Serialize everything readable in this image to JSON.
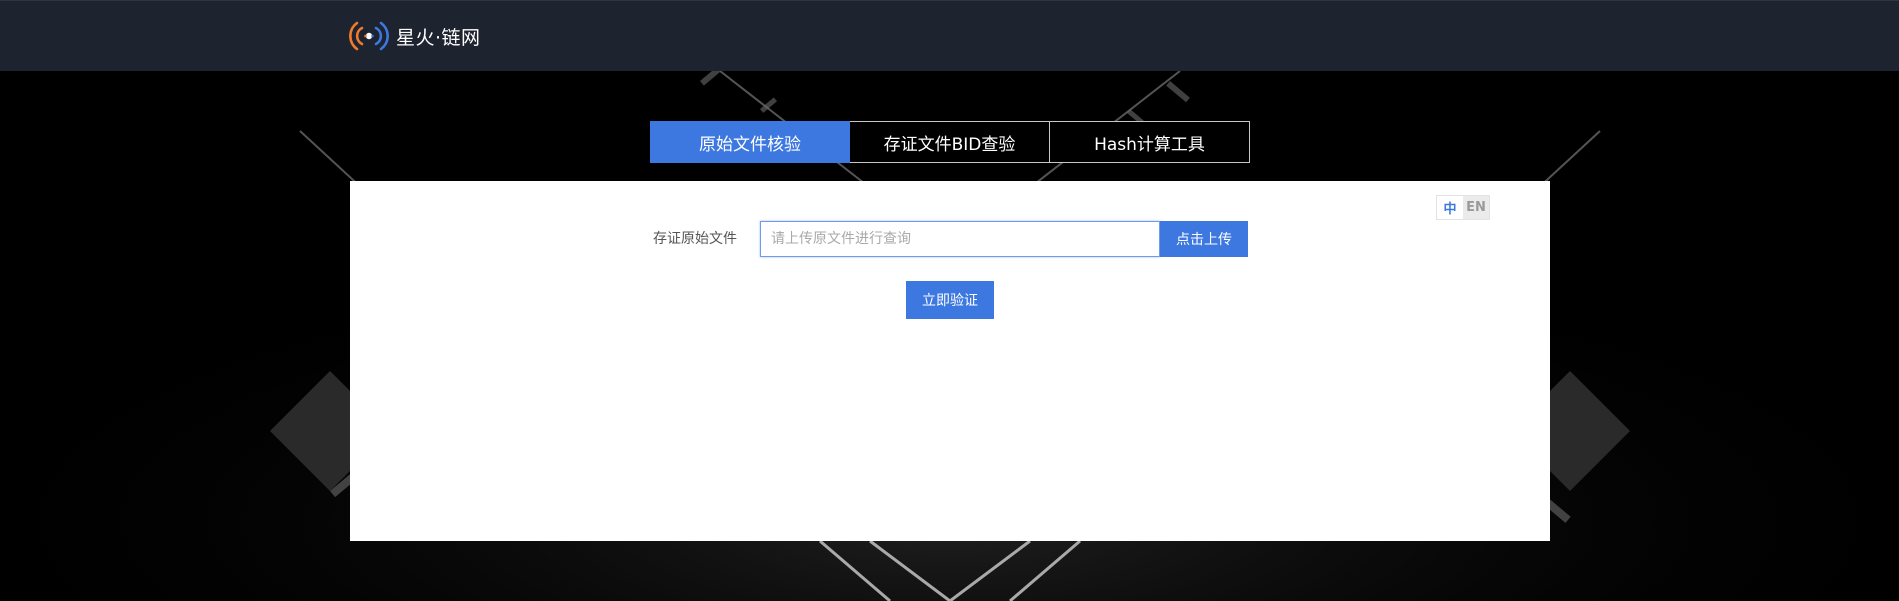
{
  "header": {
    "logo_text": "星火·链网",
    "logo_icon": "broadcast-signal-icon",
    "colors": {
      "bar_background": "#1e2330",
      "logo_orange": "#f07b2c",
      "logo_blue": "#3d78e0"
    }
  },
  "tabs": [
    {
      "label": "原始文件核验",
      "active": true
    },
    {
      "label": "存证文件BID查验",
      "active": false
    },
    {
      "label": "Hash计算工具",
      "active": false
    }
  ],
  "language_switch": {
    "options": [
      "中",
      "EN"
    ],
    "selected": "中"
  },
  "form": {
    "label": "存证原始文件",
    "input_placeholder": "请上传原文件进行查询",
    "input_value": "",
    "upload_button": "点击上传",
    "verify_button": "立即验证"
  },
  "theme": {
    "accent": "#3d78e0",
    "page_background": "#000000",
    "panel_background": "#ffffff"
  }
}
